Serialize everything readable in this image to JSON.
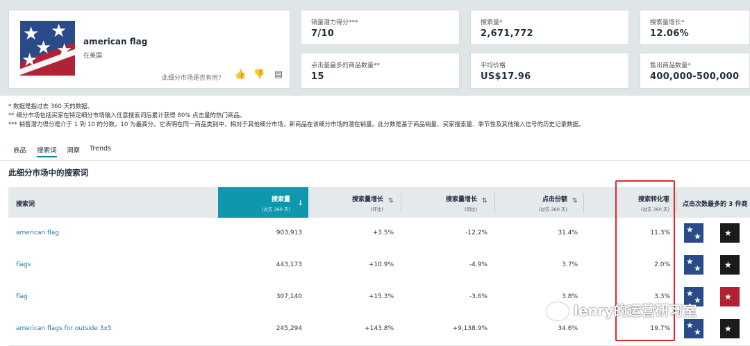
{
  "niche": {
    "title": "american flag",
    "region": "在美国",
    "useful_question": "此细分市场是否有用?"
  },
  "metrics": [
    {
      "label": "销量潜力得分***",
      "value": "7/10"
    },
    {
      "label": "搜索量*",
      "value": "2,671,772"
    },
    {
      "label": "搜索量增长*",
      "value": "12.06%"
    },
    {
      "label": "点击量最多的商品数量**",
      "value": "15"
    },
    {
      "label": "平均价格",
      "value": "US$17.96"
    },
    {
      "label": "售出商品数量*",
      "value": "400,000-500,000"
    }
  ],
  "notes": [
    "* 数据是指过去 360 天的数据。",
    "** 细分市场包括买家在特定细分市场输入任意搜索词后累计获得 80% 点击量的热门商品。",
    "*** 销售潜力得分是介于 1 到 10 的分数，10 为最高分。它表明在同一商品类别中，相对于其他细分市场，新商品在该细分市场的潜在销量。此分数是基于商品销量、买家搜索量、季节性及其他输入信号的历史记录数据。"
  ],
  "tabs": [
    "商品",
    "搜索词",
    "洞察",
    "Trends"
  ],
  "section_title": "此细分市场中的搜索词",
  "table": {
    "headers": {
      "keyword": "搜索词",
      "volume": "搜索量",
      "volume_sub": "(过去 360 天)",
      "growth_mom": "搜索量增长",
      "growth_mom_sub": "(环比)",
      "growth_yoy": "搜索量增长",
      "growth_yoy_sub": "(同比)",
      "click_share": "点击份额",
      "click_share_sub": "(过去 360 天)",
      "conversion": "搜索转化率",
      "conversion_sub": "(过去 360 天)",
      "top_clicked": "点击次数最多的 3 件商"
    },
    "rows": [
      {
        "keyword": "american flag",
        "volume": "903,913",
        "mom": "+3.5%",
        "yoy": "-12.2%",
        "share": "31.4%",
        "conv": "11.3%"
      },
      {
        "keyword": "flags",
        "volume": "443,173",
        "mom": "+10.9%",
        "yoy": "-4.9%",
        "share": "3.7%",
        "conv": "2.0%"
      },
      {
        "keyword": "flag",
        "volume": "307,140",
        "mom": "+15.3%",
        "yoy": "-3.6%",
        "share": "3.8%",
        "conv": "3.3%"
      },
      {
        "keyword": "american flags for outside 3x5",
        "volume": "245,294",
        "mom": "+143.8%",
        "yoy": "+9,138.9%",
        "share": "34.6%",
        "conv": "19.7%"
      }
    ]
  },
  "watermark": "lenry的运营研习室",
  "colors": {
    "accent": "#0f97ae",
    "highlight": "#e0262b",
    "link": "#1a7a9c"
  }
}
